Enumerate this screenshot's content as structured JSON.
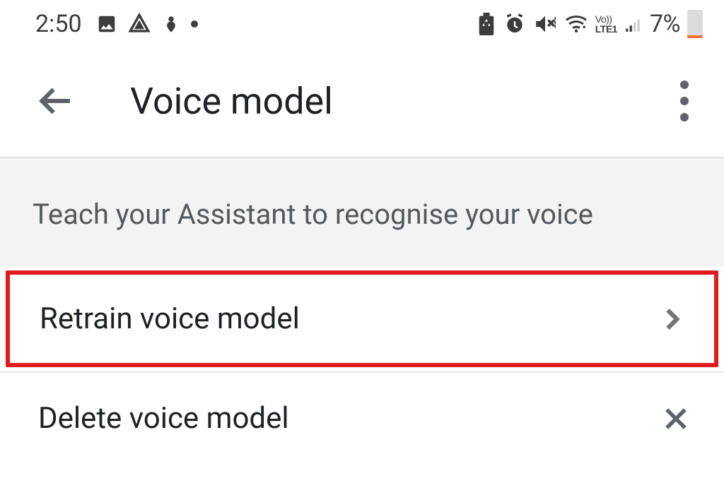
{
  "status": {
    "time": "2:50",
    "battery_text": "7%"
  },
  "header": {
    "title": "Voice model"
  },
  "section": {
    "description": "Teach your Assistant to recognise your voice"
  },
  "items": [
    {
      "label": "Retrain voice model"
    },
    {
      "label": "Delete voice model"
    }
  ]
}
